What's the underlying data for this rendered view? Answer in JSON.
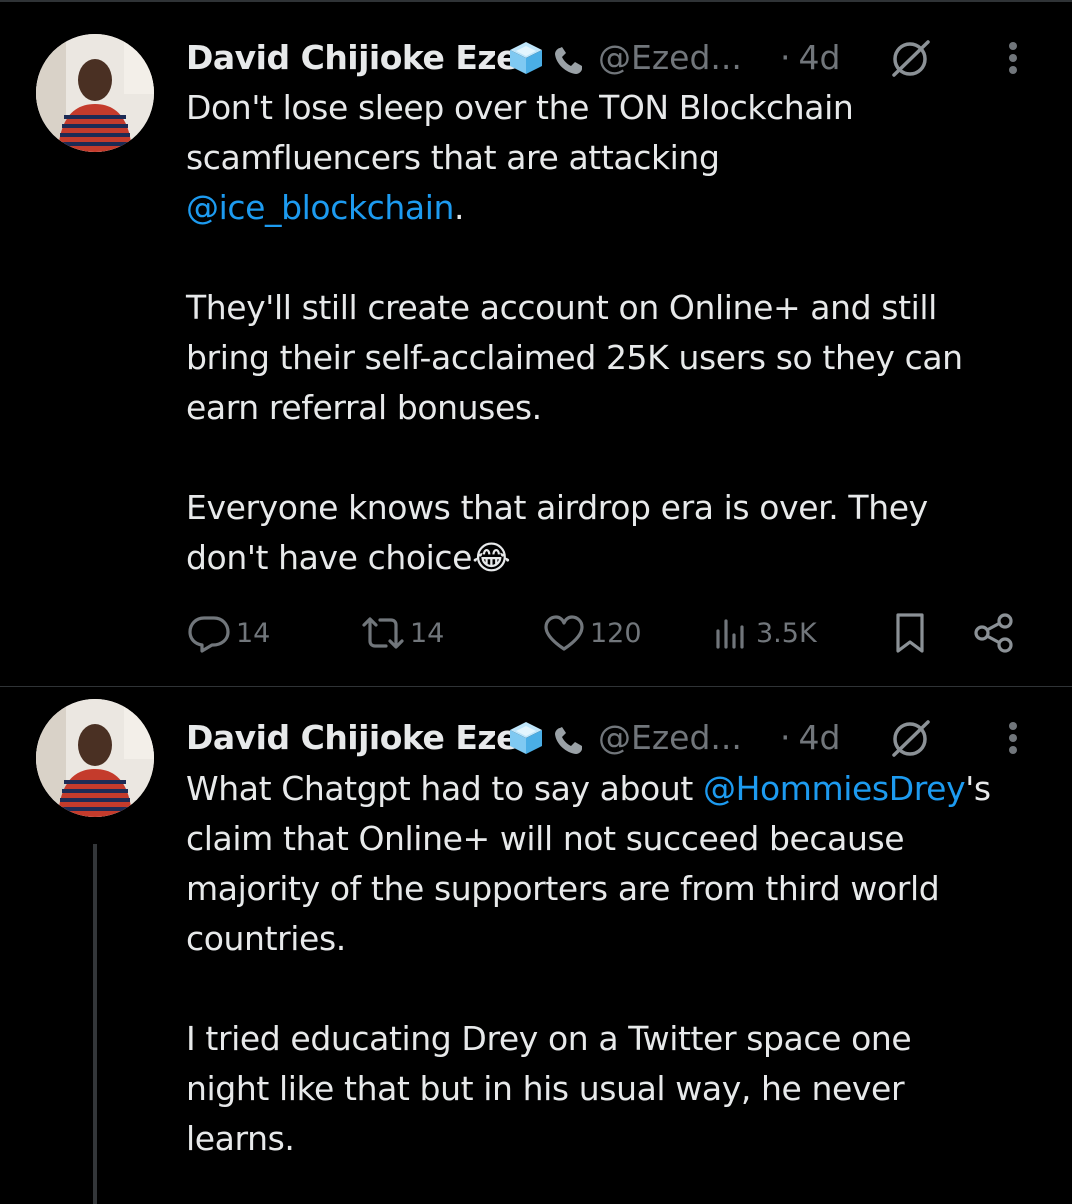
{
  "tweets": [
    {
      "author_name": "David Chijioke Eze",
      "handle": "@Ezed...",
      "separator": "·",
      "time": "4d",
      "paragraphs": [
        {
          "pre": "Don't lose sleep over the TON Blockchain\nscamfluencers that are attacking\n",
          "mention": "@ice_blockchain",
          "post": "."
        },
        {
          "pre": "They'll still create account on Online+ and still\nbring their self-acclaimed 25K users so they can\nearn referral bonuses.",
          "mention": "",
          "post": ""
        },
        {
          "pre": "Everyone knows that airdrop era is over. They\ndon't have choice😂",
          "mention": "",
          "post": ""
        }
      ],
      "stats": {
        "replies": "14",
        "reposts": "14",
        "likes": "120",
        "views": "3.5K"
      }
    },
    {
      "author_name": "David Chijioke Eze",
      "handle": "@Ezed...",
      "separator": "·",
      "time": "4d",
      "paragraphs": [
        {
          "pre": "What Chatgpt had to say about ",
          "mention": "@HommiesDrey",
          "post": "'s\nclaim that Online+ will not succeed because\nmajority of the supporters are from third world\ncountries."
        },
        {
          "pre": "I tried educating Drey on a Twitter space one\nnight like that but in his usual way, he never\nlearns.",
          "mention": "",
          "post": ""
        }
      ]
    }
  ],
  "colors": {
    "background": "#000000",
    "text": "#e7e9ea",
    "secondary": "#71767b",
    "link": "#1d9bf0",
    "divider": "#2f3336"
  },
  "icons": {
    "verified_badge": "ice-cube-icon",
    "phone": "telephone-icon",
    "grok": "grok-icon",
    "more": "more-vertical-icon",
    "reply": "reply-icon",
    "repost": "repost-icon",
    "like": "heart-icon",
    "views": "views-icon",
    "bookmark": "bookmark-icon",
    "share": "share-icon"
  }
}
